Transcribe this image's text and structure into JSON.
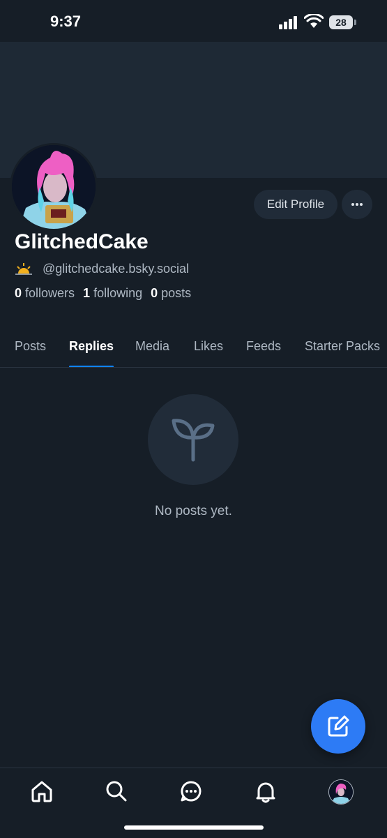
{
  "status_bar": {
    "time": "9:37",
    "battery": "28"
  },
  "profile": {
    "display_name": "GlitchedCake",
    "handle": "@glitchedcake.bsky.social",
    "edit_label": "Edit Profile",
    "stats": [
      {
        "count": "0",
        "label": "followers"
      },
      {
        "count": "1",
        "label": "following"
      },
      {
        "count": "0",
        "label": "posts"
      }
    ]
  },
  "tabs": [
    {
      "label": "Posts",
      "active": false
    },
    {
      "label": "Replies",
      "active": true
    },
    {
      "label": "Media",
      "active": false
    },
    {
      "label": "Likes",
      "active": false
    },
    {
      "label": "Feeds",
      "active": false
    },
    {
      "label": "Starter Packs",
      "active": false
    }
  ],
  "empty_state": {
    "message": "No posts yet.",
    "icon": "seedling-icon"
  },
  "bottom_nav": [
    "home-icon",
    "search-icon",
    "chat-icon",
    "bell-icon",
    "profile-avatar"
  ],
  "colors": {
    "accent": "#1083fe",
    "fab": "#2d7bf5",
    "background": "#161e27",
    "banner": "#1e2935"
  }
}
